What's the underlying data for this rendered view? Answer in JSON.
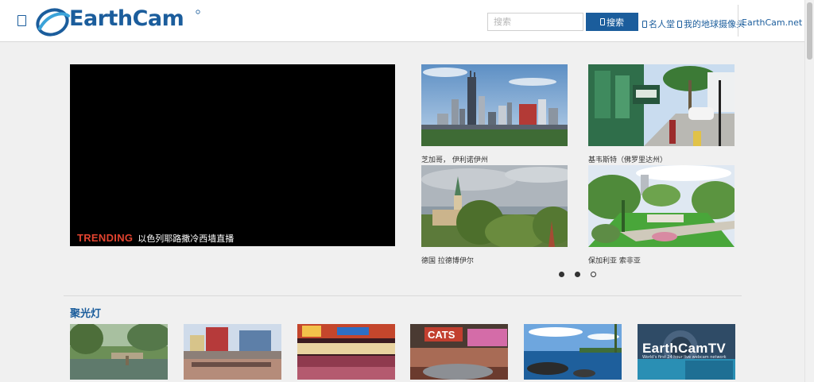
{
  "header": {
    "logo_text": "EarthCam",
    "search": {
      "placeholder": "搜索",
      "button_label": "搜索"
    },
    "nav": {
      "hall_of_fame": "名人堂",
      "my_earth_cams": "我的地球摄像头",
      "earthcam_net": "EarthCam.net"
    }
  },
  "player": {
    "trending_tag": "TRENDING",
    "trending_title": "以色列耶路撒冷西墙直播"
  },
  "featured_cams": [
    {
      "caption": "芝加哥， 伊利诺伊州",
      "icon": "chicago-skyline-thumbnail"
    },
    {
      "caption": "基韦斯特（佛罗里达州）",
      "icon": "key-west-street-thumbnail"
    },
    {
      "caption": "德国 拉德博伊尔",
      "icon": "radebeul-church-thumbnail"
    },
    {
      "caption": "保加利亚 索非亚",
      "icon": "sofia-park-thumbnail"
    }
  ],
  "carousel": {
    "page_count": 3,
    "active_index": 1
  },
  "spotlight": {
    "title": "聚光灯",
    "items": [
      {
        "icon": "zoo-lagoon-thumbnail"
      },
      {
        "icon": "boardwalk-crowd-thumbnail"
      },
      {
        "icon": "vegas-crowd-thumbnail"
      },
      {
        "icon": "cats-theater-thumbnail"
      },
      {
        "icon": "ocean-coast-thumbnail"
      },
      {
        "icon": "earthcamtv-thumbnail",
        "overlay_title": "EarthCamTV",
        "overlay_subtitle": "World's first 24 hour live webcam network"
      }
    ]
  },
  "colors": {
    "brand_blue": "#1b5d9c",
    "trending_red": "#e2432f",
    "page_bg": "#f0f0f0"
  }
}
